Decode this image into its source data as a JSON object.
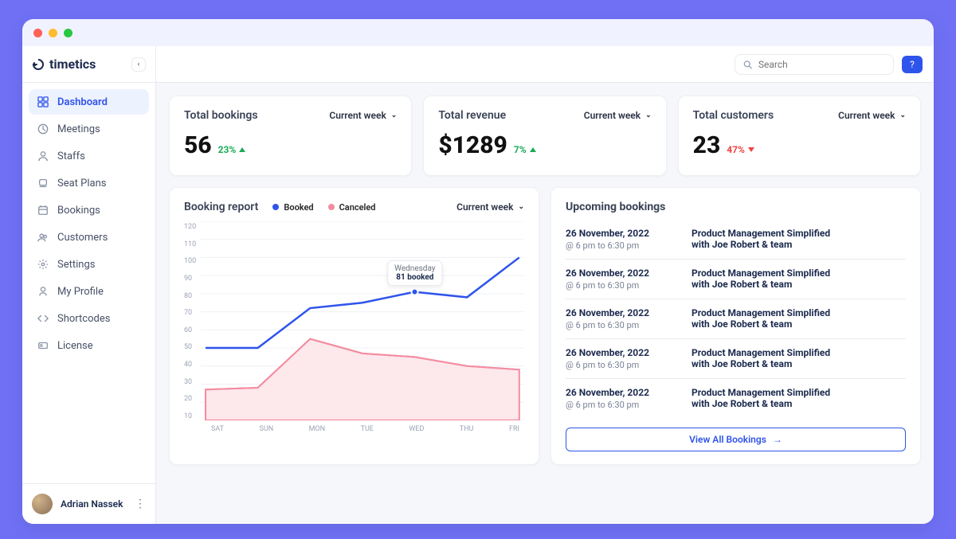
{
  "brand": "timetics",
  "search_placeholder": "Search",
  "sidebar": {
    "items": [
      {
        "label": "Dashboard",
        "icon": "grid-icon",
        "active": true,
        "name": "sidebar-item-dashboard"
      },
      {
        "label": "Meetings",
        "icon": "clock-icon",
        "active": false,
        "name": "sidebar-item-meetings"
      },
      {
        "label": "Staffs",
        "icon": "user-icon",
        "active": false,
        "name": "sidebar-item-staffs"
      },
      {
        "label": "Seat Plans",
        "icon": "seat-icon",
        "active": false,
        "name": "sidebar-item-seat-plans"
      },
      {
        "label": "Bookings",
        "icon": "calendar-icon",
        "active": false,
        "name": "sidebar-item-bookings"
      },
      {
        "label": "Customers",
        "icon": "users-icon",
        "active": false,
        "name": "sidebar-item-customers"
      },
      {
        "label": "Settings",
        "icon": "gear-icon",
        "active": false,
        "name": "sidebar-item-settings"
      },
      {
        "label": "My Profile",
        "icon": "profile-icon",
        "active": false,
        "name": "sidebar-item-my-profile"
      },
      {
        "label": "Shortcodes",
        "icon": "code-icon",
        "active": false,
        "name": "sidebar-item-shortcodes"
      },
      {
        "label": "License",
        "icon": "license-icon",
        "active": false,
        "name": "sidebar-item-license"
      }
    ]
  },
  "user": {
    "name": "Adrian Nassek"
  },
  "metrics": {
    "bookings": {
      "title": "Total bookings",
      "value": "56",
      "delta": "23%",
      "direction": "up",
      "range": "Current week"
    },
    "revenue": {
      "title": "Total revenue",
      "value": "$1289",
      "delta": "7%",
      "direction": "up",
      "range": "Current week"
    },
    "customers": {
      "title": "Total customers",
      "value": "23",
      "delta": "47%",
      "direction": "down",
      "range": "Current week"
    }
  },
  "booking_report": {
    "title": "Booking report",
    "legend_booked": "Booked",
    "legend_canceled": "Canceled",
    "range": "Current week",
    "tooltip_day": "Wednesday",
    "tooltip_val": "81 booked"
  },
  "upcoming": {
    "title": "Upcoming bookings",
    "view_all": "View All Bookings",
    "items": [
      {
        "date": "26 November, 2022",
        "time": "@ 6 pm to 6:30 pm",
        "event": "Product Management Simplified",
        "by": "with Joe Robert & team"
      },
      {
        "date": "26 November, 2022",
        "time": "@ 6 pm to 6:30 pm",
        "event": "Product Management Simplified",
        "by": "with Joe Robert & team"
      },
      {
        "date": "26 November, 2022",
        "time": "@ 6 pm to 6:30 pm",
        "event": "Product Management Simplified",
        "by": "with Joe Robert & team"
      },
      {
        "date": "26 November, 2022",
        "time": "@ 6 pm to 6:30 pm",
        "event": "Product Management Simplified",
        "by": "with Joe Robert & team"
      },
      {
        "date": "26 November, 2022",
        "time": "@ 6 pm to 6:30 pm",
        "event": "Product Management Simplified",
        "by": "with Joe Robert & team"
      }
    ]
  },
  "chart_data": {
    "type": "line",
    "title": "Booking report",
    "xlabel": "",
    "ylabel": "",
    "ylim": [
      10,
      120
    ],
    "y_ticks": [
      120,
      110,
      100,
      90,
      80,
      70,
      60,
      50,
      40,
      30,
      20,
      10
    ],
    "categories": [
      "SAT",
      "SUN",
      "MON",
      "TUE",
      "WED",
      "THU",
      "FRI"
    ],
    "series": [
      {
        "name": "Booked",
        "color": "#2f54eb",
        "values": [
          50,
          50,
          72,
          75,
          81,
          78,
          100
        ]
      },
      {
        "name": "Canceled",
        "color": "#f48ca0",
        "values": [
          27,
          28,
          55,
          47,
          45,
          40,
          38
        ]
      }
    ],
    "tooltip": {
      "x": "WED",
      "label": "Wednesday",
      "text": "81 booked"
    }
  }
}
